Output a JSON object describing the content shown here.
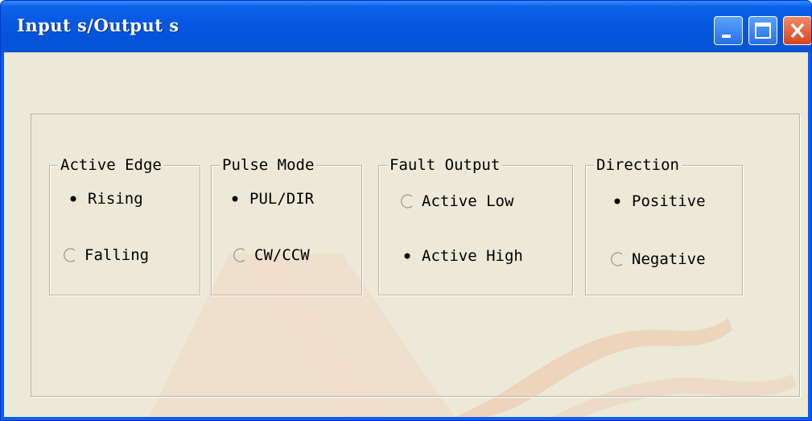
{
  "window": {
    "title": "Input s/Output s"
  },
  "groups": [
    {
      "id": "active-edge",
      "legend": "Active Edge",
      "options": [
        {
          "label": "Rising",
          "selected": true
        },
        {
          "label": "Falling",
          "selected": false
        }
      ]
    },
    {
      "id": "pulse-mode",
      "legend": "Pulse Mode",
      "options": [
        {
          "label": "PUL/DIR",
          "selected": true
        },
        {
          "label": "CW/CCW",
          "selected": false
        }
      ]
    },
    {
      "id": "fault-output",
      "legend": "Fault Output",
      "options": [
        {
          "label": "Active Low",
          "selected": false
        },
        {
          "label": "Active High",
          "selected": true
        }
      ]
    },
    {
      "id": "direction",
      "legend": "Direction",
      "options": [
        {
          "label": "Positive",
          "selected": true
        },
        {
          "label": "Negative",
          "selected": false
        }
      ]
    }
  ],
  "colors": {
    "titlebar": "#0657e0",
    "dialog_face": "#ece9d8",
    "watermark": "#e8b9a0"
  }
}
